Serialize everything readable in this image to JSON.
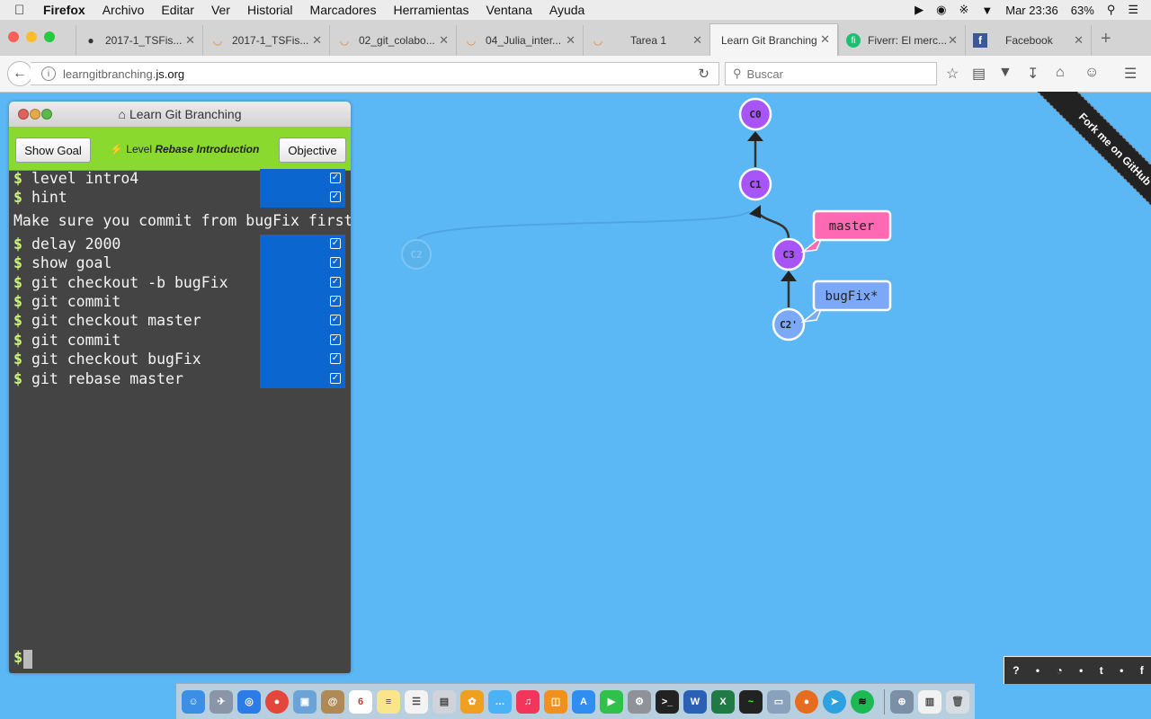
{
  "menubar": {
    "items": [
      "Firefox",
      "Archivo",
      "Editar",
      "Ver",
      "Historial",
      "Marcadores",
      "Herramientas",
      "Ventana",
      "Ayuda"
    ],
    "clock": "Mar 23:36",
    "battery": "63%"
  },
  "tabs": [
    {
      "label": "2017-1_TSFis...",
      "icon": "github-icon"
    },
    {
      "label": "2017-1_TSFis...",
      "icon": "loading-spinner-icon"
    },
    {
      "label": "02_git_colabo...",
      "icon": "loading-spinner-icon"
    },
    {
      "label": "04_Julia_inter...",
      "icon": "loading-spinner-icon"
    },
    {
      "label": "Tarea 1",
      "icon": "loading-spinner-icon"
    },
    {
      "label": "Learn Git Branching",
      "icon": "none"
    },
    {
      "label": "Fiverr: El merc...",
      "icon": "fiverr-icon"
    },
    {
      "label": "Facebook",
      "icon": "facebook-icon"
    }
  ],
  "nav": {
    "url_prefix": "learngitbranching.",
    "url_host": "js.org",
    "search_placeholder": "Buscar"
  },
  "panel": {
    "title": "Learn Git Branching",
    "show_goal": "Show Goal",
    "level_prefix": "Level",
    "level_name": "Rebase Introduction",
    "objective": "Objective",
    "commands_top": [
      "level intro4",
      "hint"
    ],
    "hint": "Make sure you commit from bugFix first",
    "commands": [
      "delay 2000",
      "show goal",
      "git checkout -b bugFix",
      "git commit",
      "git checkout master",
      "git commit",
      "git checkout bugFix",
      "git rebase master"
    ],
    "prompt": "$"
  },
  "graph": {
    "nodes": [
      "C0",
      "C1",
      "C3",
      "C2'",
      "C2"
    ],
    "branches": [
      {
        "name": "master",
        "color": "#ff69b4"
      },
      {
        "name": "bugFix*",
        "color": "#7ca9f7"
      }
    ],
    "node_color": "#a855f7",
    "ghost_color": "#5ab3ea"
  },
  "ribbon": "Fork me on GitHub",
  "help": [
    "?",
    "•",
    "◔",
    "•",
    "t",
    "•",
    "f"
  ],
  "colors": {
    "background": "#5cb8f5",
    "panel_bg": "#444444",
    "toolbar_green": "#89d92f",
    "status_blue": "#0b66d0"
  },
  "dock_icons": [
    "Finder",
    "Launchpad",
    "Safari",
    "Chrome",
    "Preview",
    "Contacts",
    "Calendar",
    "Notes",
    "Reminders",
    "Photos",
    "Photos2",
    "Messages",
    "Music",
    "iBooks",
    "AppStore",
    "FaceTime",
    "Preferences",
    "Terminal",
    "Word",
    "Excel",
    "ActivityMonitor",
    "Screenshot",
    "Firefox",
    "Telegram",
    "Spotify",
    "Finder2",
    "Documents",
    "Trash"
  ]
}
